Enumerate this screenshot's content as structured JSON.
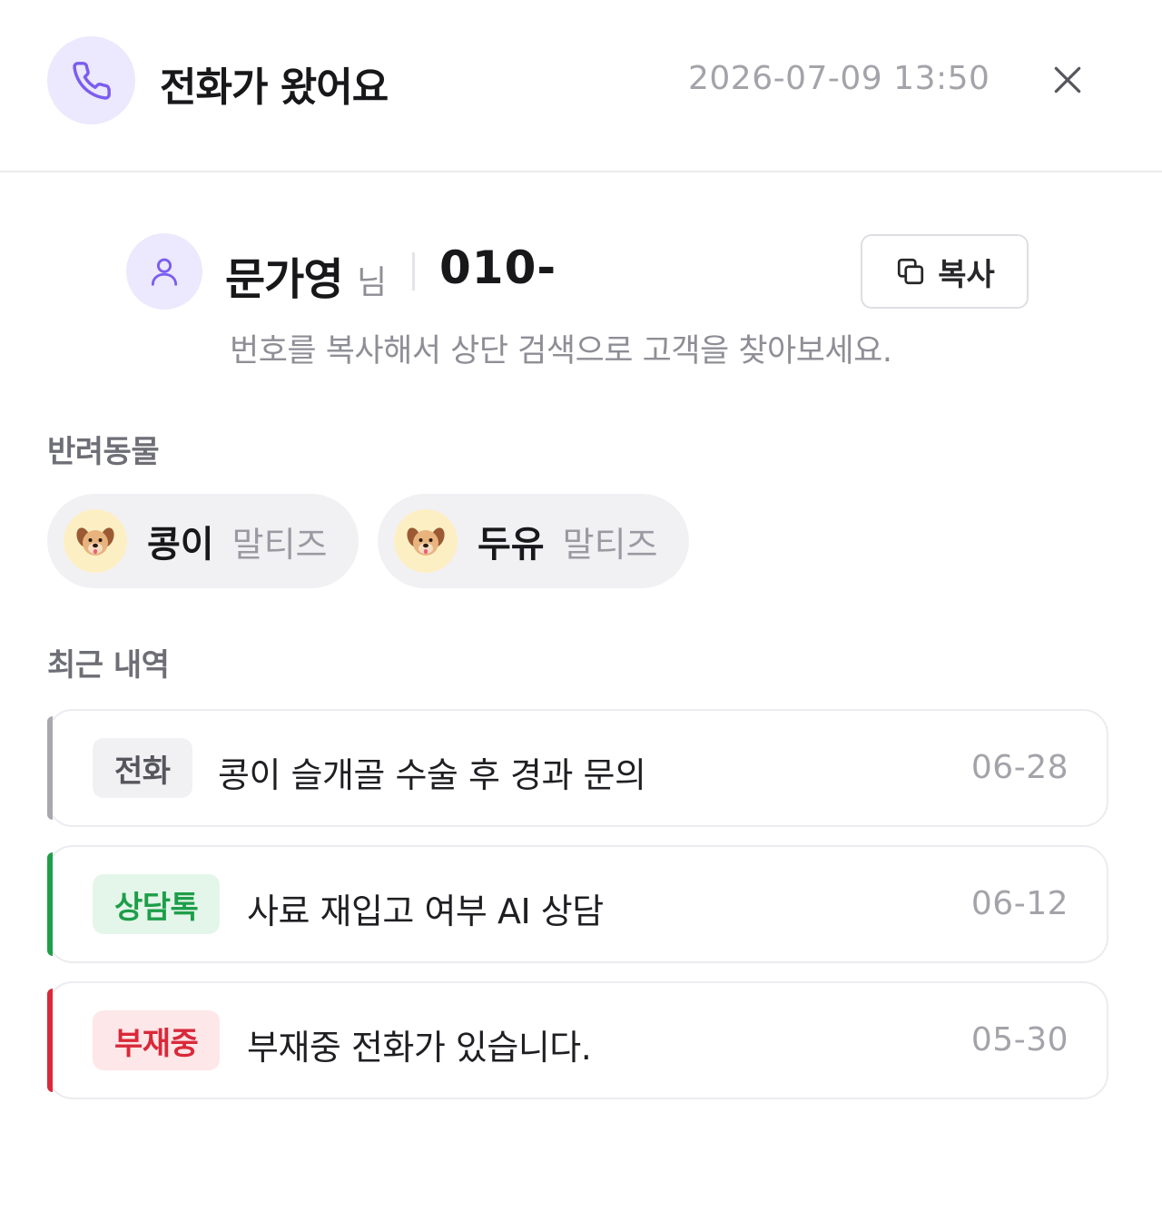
{
  "header": {
    "icon": "phone-icon",
    "title": "전화가 왔어요",
    "timestamp": "2026-07-09 13:50",
    "close_icon": "close-icon"
  },
  "customer": {
    "avatar_icon": "user-icon",
    "name": "문가영",
    "honorific": "님",
    "phone_visible": "010-",
    "copy_button": {
      "icon": "copy-icon",
      "label": "복사"
    },
    "hint": "번호를 복사해서 상단 검색으로 고객을 찾아보세요."
  },
  "pets": {
    "label": "반려동물",
    "items": [
      {
        "icon": "dog-icon",
        "name": "콩이",
        "breed": "말티즈"
      },
      {
        "icon": "dog-icon",
        "name": "두유",
        "breed": "말티즈"
      }
    ]
  },
  "recent": {
    "label": "최근 내역",
    "items": [
      {
        "type": "전화",
        "text": "콩이 슬개골 수술 후 경과 문의",
        "date": "06-28",
        "accent": "#a8a8ae",
        "badge_bg": "#f1f1f4",
        "badge_fg": "#55555c"
      },
      {
        "type": "상담톡",
        "text": "사료 재입고 여부 AI 상담",
        "date": "06-12",
        "accent": "#1e9e49",
        "badge_bg": "#e4f6ea",
        "badge_fg": "#1e9e49"
      },
      {
        "type": "부재중",
        "text": "부재중 전화가 있습니다.",
        "date": "05-30",
        "accent": "#d9293a",
        "badge_bg": "#fde7e8",
        "badge_fg": "#d9293a"
      }
    ]
  }
}
